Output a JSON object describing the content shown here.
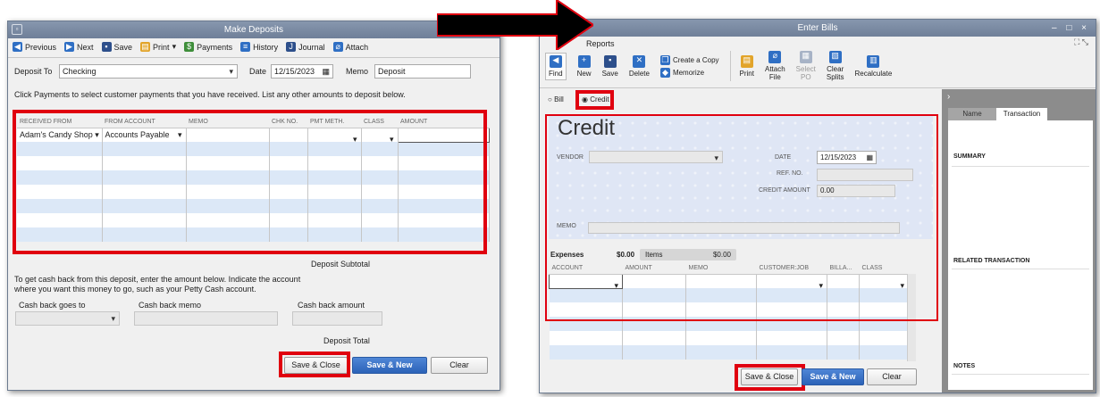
{
  "deposits": {
    "title": "Make Deposits",
    "toolbar": {
      "previous": "Previous",
      "next": "Next",
      "save": "Save",
      "print": "Print",
      "payments": "Payments",
      "history": "History",
      "journal": "Journal",
      "attach": "Attach"
    },
    "deposit_to_label": "Deposit To",
    "deposit_to_value": "Checking",
    "date_label": "Date",
    "date_value": "12/15/2023",
    "memo_label": "Memo",
    "memo_value": "Deposit",
    "instructions": "Click Payments to select customer payments that you have received. List any other amounts to deposit below.",
    "columns": [
      "RECEIVED FROM",
      "FROM ACCOUNT",
      "MEMO",
      "CHK NO.",
      "PMT METH.",
      "CLASS",
      "AMOUNT"
    ],
    "row1": {
      "received_from": "Adam's Candy Shop",
      "from_account": "Accounts Payable"
    },
    "subtotal_label": "Deposit Subtotal",
    "cashback_text_1": "To get cash back from this deposit, enter the amount below.  Indicate the account",
    "cashback_text_2": "where you want this money to go, such as your Petty Cash account.",
    "cashback_goes_to_label": "Cash back goes to",
    "cashback_memo_label": "Cash back memo",
    "cashback_amount_label": "Cash back amount",
    "total_label": "Deposit Total",
    "save_close": "Save & Close",
    "save_new": "Save & New",
    "clear": "Clear"
  },
  "bills": {
    "title": "Enter Bills",
    "window_controls": "– □ ×",
    "reports_tab": "Reports",
    "toolbar": {
      "find": "Find",
      "new": "New",
      "save": "Save",
      "delete": "Delete",
      "create_copy": "Create a Copy",
      "memorize": "Memorize",
      "print": "Print",
      "attach_file_1": "Attach",
      "attach_file_2": "File",
      "select_po_1": "Select",
      "select_po_2": "PO",
      "clear_splits_1": "Clear",
      "clear_splits_2": "Splits",
      "recalculate": "Recalculate"
    },
    "radio_bill": "Bill",
    "radio_credit": "Credit",
    "form_title": "Credit",
    "vendor_label": "VENDOR",
    "date_label": "DATE",
    "date_value": "12/15/2023",
    "ref_label": "REF. NO.",
    "credit_amount_label": "CREDIT AMOUNT",
    "credit_amount_value": "0.00",
    "memo_label": "MEMO",
    "expenses_tab": "Expenses",
    "expenses_amount": "$0.00",
    "items_tab": "Items",
    "items_amount": "$0.00",
    "columns": [
      "ACCOUNT",
      "AMOUNT",
      "MEMO",
      "CUSTOMER:JOB",
      "BILLA...",
      "CLASS"
    ],
    "save_close": "Save & Close",
    "save_new": "Save & New",
    "clear": "Clear",
    "side_tab_name": "Name",
    "side_tab_transaction": "Transaction",
    "summary": "SUMMARY",
    "related": "RELATED TRANSACTION",
    "notes": "NOTES"
  }
}
